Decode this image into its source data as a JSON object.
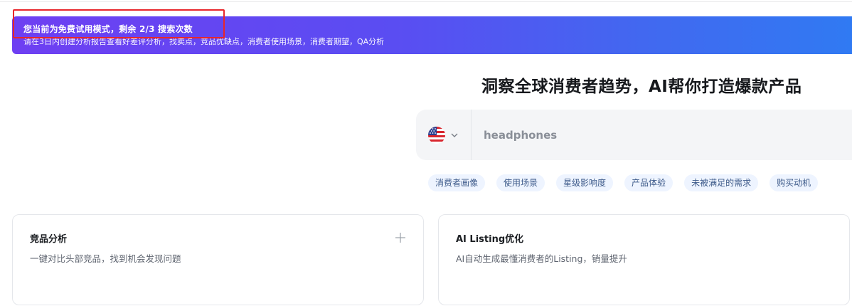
{
  "banner": {
    "title": "您当前为免费试用模式，剩余 2/3 搜索次数",
    "subtitle": "请在3日内创建分析报告查看好差评分析，找卖点，竞品优缺点，消费者使用场景，消费者期望，QA分析"
  },
  "hero": {
    "title": "洞察全球消费者趋势，AI帮你打造爆款产品"
  },
  "search": {
    "region_icon": "us-flag-icon",
    "placeholder": "headphones"
  },
  "tags": [
    "消费者画像",
    "使用场景",
    "星级影响度",
    "产品体验",
    "未被满足的需求",
    "购买动机"
  ],
  "cards": [
    {
      "title": "竞品分析",
      "desc": "一键对比头部竞品，找到机会发现问题",
      "icon": "plus-icon"
    },
    {
      "title": "AI Listing优化",
      "desc": "AI自动生成最懂消费者的Listing，销量提升"
    }
  ],
  "colors": {
    "banner_start": "#6e3ff2",
    "banner_end": "#2f7bf3",
    "highlight": "#e8262b",
    "tag_bg": "#eef4ff"
  }
}
